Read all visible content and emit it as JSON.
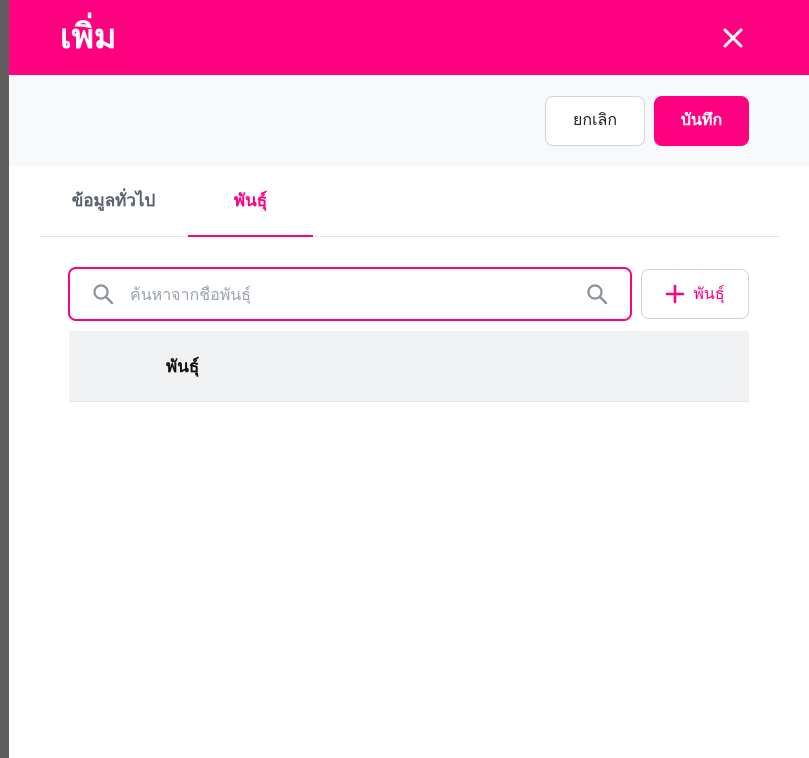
{
  "modal": {
    "title": "เพิ่ม",
    "actions": {
      "cancel_label": "ยกเลิก",
      "save_label": "บันทึก"
    },
    "tabs": [
      {
        "label": "ข้อมูลทั่วไป",
        "active": false
      },
      {
        "label": "พันธุ์",
        "active": true
      }
    ],
    "search": {
      "placeholder": "ค้นหาจากชื่อพันธุ์",
      "value": ""
    },
    "add_button_label": "พันธุ์",
    "table": {
      "columns": [
        "พันธุ์"
      ],
      "rows": []
    }
  },
  "colors": {
    "accent": "#ff0080",
    "header_bg": "#ff0080",
    "action_bar_bg": "#f8f9fb",
    "table_header_bg": "#f1f2f4"
  },
  "icons": {
    "close": "close-icon",
    "search": "search-icon",
    "add": "plus-icon"
  }
}
